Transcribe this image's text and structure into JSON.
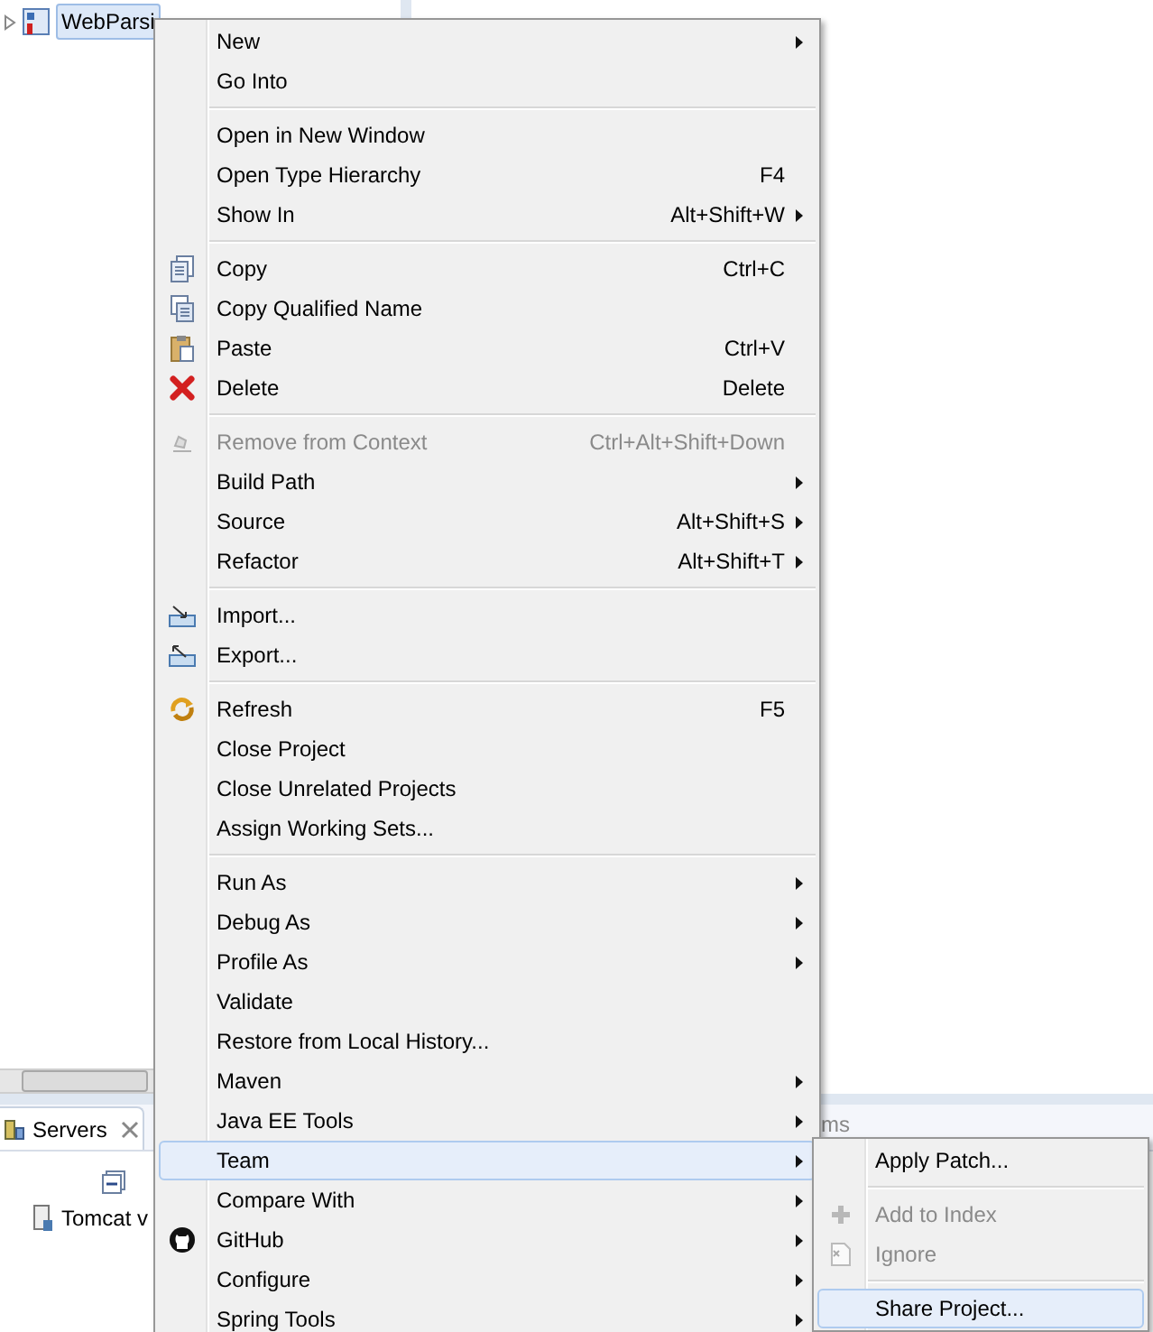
{
  "project_tree": {
    "items": [
      {
        "label": "WebParsi",
        "selected": true
      }
    ]
  },
  "servers_view": {
    "tab": {
      "label": "Servers"
    },
    "items": [
      {
        "label": "Tomcat v"
      }
    ],
    "other_tab_fragment": "ms"
  },
  "context_menu": {
    "items": [
      {
        "kind": "item",
        "label": "New",
        "submenu": true
      },
      {
        "kind": "item",
        "label": "Go Into"
      },
      {
        "kind": "separator"
      },
      {
        "kind": "item",
        "label": "Open in New Window"
      },
      {
        "kind": "item",
        "label": "Open Type Hierarchy",
        "shortcut": "F4"
      },
      {
        "kind": "item",
        "label": "Show In",
        "shortcut": "Alt+Shift+W",
        "submenu": true
      },
      {
        "kind": "separator"
      },
      {
        "kind": "item",
        "label": "Copy",
        "shortcut": "Ctrl+C"
      },
      {
        "kind": "item",
        "label": "Copy Qualified Name"
      },
      {
        "kind": "item",
        "label": "Paste",
        "shortcut": "Ctrl+V"
      },
      {
        "kind": "item",
        "label": "Delete",
        "shortcut": "Delete"
      },
      {
        "kind": "separator"
      },
      {
        "kind": "item",
        "label": "Remove from Context",
        "shortcut": "Ctrl+Alt+Shift+Down",
        "disabled": true
      },
      {
        "kind": "item",
        "label": "Build Path",
        "submenu": true
      },
      {
        "kind": "item",
        "label": "Source",
        "shortcut": "Alt+Shift+S",
        "submenu": true
      },
      {
        "kind": "item",
        "label": "Refactor",
        "shortcut": "Alt+Shift+T",
        "submenu": true
      },
      {
        "kind": "separator"
      },
      {
        "kind": "item",
        "label": "Import..."
      },
      {
        "kind": "item",
        "label": "Export..."
      },
      {
        "kind": "separator"
      },
      {
        "kind": "item",
        "label": "Refresh",
        "shortcut": "F5"
      },
      {
        "kind": "item",
        "label": "Close Project"
      },
      {
        "kind": "item",
        "label": "Close Unrelated Projects"
      },
      {
        "kind": "item",
        "label": "Assign Working Sets..."
      },
      {
        "kind": "separator"
      },
      {
        "kind": "item",
        "label": "Run As",
        "submenu": true
      },
      {
        "kind": "item",
        "label": "Debug As",
        "submenu": true
      },
      {
        "kind": "item",
        "label": "Profile As",
        "submenu": true
      },
      {
        "kind": "item",
        "label": "Validate"
      },
      {
        "kind": "item",
        "label": "Restore from Local History..."
      },
      {
        "kind": "item",
        "label": "Maven",
        "submenu": true
      },
      {
        "kind": "item",
        "label": "Java EE Tools",
        "submenu": true
      },
      {
        "kind": "item",
        "label": "Team",
        "submenu": true,
        "selected": true
      },
      {
        "kind": "item",
        "label": "Compare With",
        "submenu": true
      },
      {
        "kind": "item",
        "label": "GitHub",
        "submenu": true
      },
      {
        "kind": "item",
        "label": "Configure",
        "submenu": true
      },
      {
        "kind": "item",
        "label": "Spring Tools",
        "submenu": true
      }
    ]
  },
  "team_submenu": {
    "items": [
      {
        "kind": "item",
        "label": "Apply Patch..."
      },
      {
        "kind": "separator"
      },
      {
        "kind": "item",
        "label": "Add to Index",
        "disabled": true
      },
      {
        "kind": "item",
        "label": "Ignore",
        "disabled": true
      },
      {
        "kind": "separator"
      },
      {
        "kind": "item",
        "label": "Share Project...",
        "selected": true
      }
    ]
  }
}
